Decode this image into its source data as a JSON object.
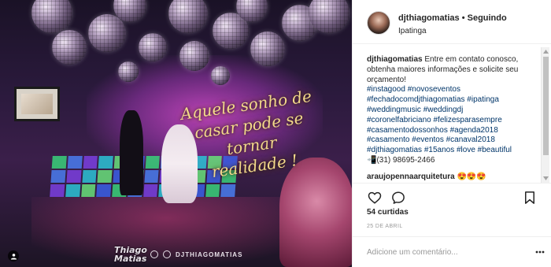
{
  "photo": {
    "headline_lines": [
      "Aquele sonho de",
      "casar pode se tornar",
      "realidade !"
    ],
    "brand_logo_text": "Thiago Matias",
    "brand_handle": "DJTHIAGOMATIAS"
  },
  "post_header": {
    "username": "djthiagomatias",
    "separator": "•",
    "follow_status": "Seguindo",
    "location": "Ipatinga"
  },
  "caption": {
    "username": "djthiagomatias",
    "lines": [
      {
        "text": "Entre em contato conosco,",
        "kind": "text",
        "with_user": true
      },
      {
        "text": "obtenha maiores informações e solicite seu",
        "kind": "text"
      },
      {
        "text": "orçamento!",
        "kind": "text"
      },
      {
        "text": "#instagood #novoseventos",
        "kind": "tag"
      },
      {
        "text": "#fechadocomdjthiagomatias #ipatinga",
        "kind": "tag"
      },
      {
        "text": "#weddingmusic #weddingdj",
        "kind": "tag"
      },
      {
        "text": "#coronelfabriciano #felizesparasempre",
        "kind": "tag"
      },
      {
        "text": "#casamentodossonhos #agenda2018",
        "kind": "tag"
      },
      {
        "text": "#casamento #eventos #canaval2018",
        "kind": "tag"
      },
      {
        "text": "#djthiagomatias #15anos #love #beautiful",
        "kind": "tag"
      },
      {
        "text": "📲(31) 98695-2466",
        "kind": "text"
      }
    ]
  },
  "comment": {
    "username": "araujopennaarquitetura",
    "text": "😍😍😍"
  },
  "actions": {
    "like_icon": "heart-icon",
    "comment_icon": "comment-icon",
    "save_icon": "bookmark-icon"
  },
  "likes_text": "54 curtidas",
  "date_text": "25 DE ABRIL",
  "add_comment": {
    "placeholder": "Adicione um comentário..."
  },
  "colors": {
    "accent_link": "#003569",
    "muted": "#999999",
    "text": "#262626"
  }
}
